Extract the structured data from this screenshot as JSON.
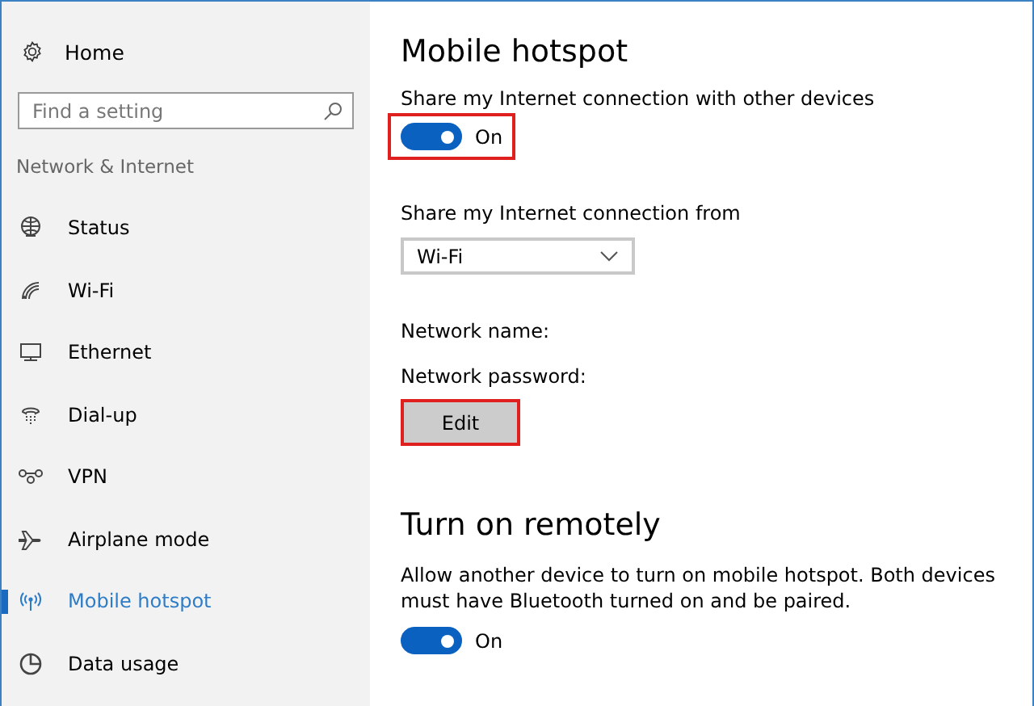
{
  "sidebar": {
    "home": "Home",
    "search": {
      "placeholder": "Find a setting"
    },
    "section": "Network & Internet",
    "items": [
      {
        "label": "Status",
        "selected": false
      },
      {
        "label": "Wi-Fi",
        "selected": false
      },
      {
        "label": "Ethernet",
        "selected": false
      },
      {
        "label": "Dial-up",
        "selected": false
      },
      {
        "label": "VPN",
        "selected": false
      },
      {
        "label": "Airplane mode",
        "selected": false
      },
      {
        "label": "Mobile hotspot",
        "selected": true
      },
      {
        "label": "Data usage",
        "selected": false
      }
    ]
  },
  "main": {
    "title": "Mobile hotspot",
    "share_toggle": {
      "label": "Share my Internet connection with other devices",
      "on": true,
      "state_text": "On",
      "highlighted": true
    },
    "share_from": {
      "label": "Share my Internet connection from",
      "value": "Wi-Fi"
    },
    "network_name": "Network name:",
    "network_password": "Network password:",
    "edit_button": {
      "label": "Edit",
      "highlighted": true
    },
    "remote": {
      "title": "Turn on remotely",
      "description": "Allow another device to turn on mobile hotspot. Both devices must have Bluetooth turned on and be paired.",
      "on": true,
      "state_text": "On",
      "highlighted": false
    }
  }
}
